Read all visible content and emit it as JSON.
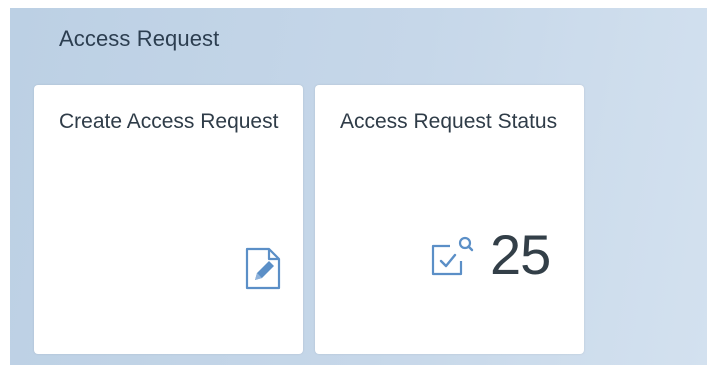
{
  "group": {
    "title": "Access Request"
  },
  "tiles": [
    {
      "title": "Create Access Request",
      "icon": "edit-document-icon"
    },
    {
      "title": "Access Request Status",
      "icon": "check-document-search-icon",
      "kpi_value": "25"
    }
  ],
  "colors": {
    "background": "#c6d7e9",
    "tile": "#ffffff",
    "icon": "#5b8fc7",
    "text": "#2f3c48"
  }
}
